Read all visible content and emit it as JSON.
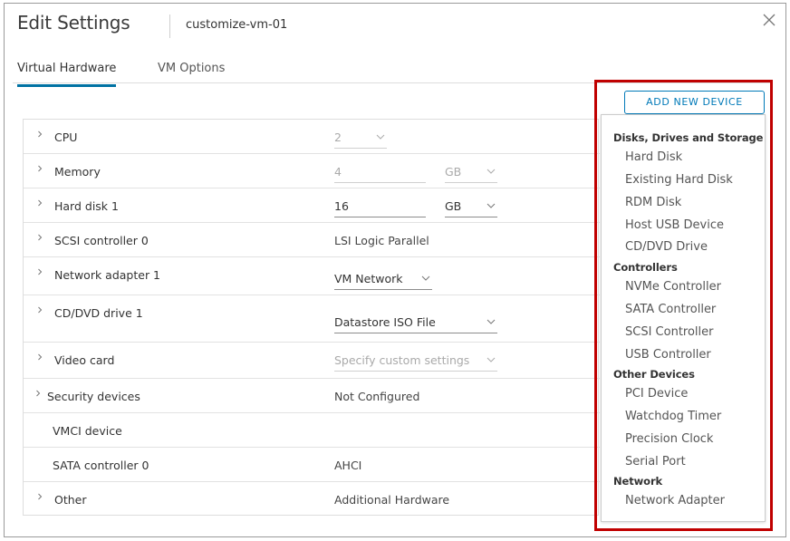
{
  "dialog": {
    "title": "Edit Settings",
    "vm_name": "customize-vm-01"
  },
  "tabs": [
    {
      "label": "Virtual Hardware",
      "active": true
    },
    {
      "label": "VM Options",
      "active": false
    }
  ],
  "add_device": {
    "label": "ADD NEW DEVICE"
  },
  "hardware": {
    "cpu": {
      "label": "CPU",
      "value": "2"
    },
    "memory": {
      "label": "Memory",
      "value": "4",
      "unit": "GB"
    },
    "hard_disk": {
      "label": "Hard disk 1",
      "value": "16",
      "unit": "GB"
    },
    "scsi": {
      "label": "SCSI controller 0",
      "value": "LSI Logic Parallel"
    },
    "network": {
      "label": "Network adapter 1",
      "value": "VM Network"
    },
    "cdvd": {
      "label": "CD/DVD drive 1",
      "value": "Datastore ISO File"
    },
    "video": {
      "label": "Video card",
      "value": "Specify custom settings"
    },
    "security": {
      "label": "Security devices",
      "value": "Not Configured"
    },
    "vmci": {
      "label": "VMCI device",
      "value": ""
    },
    "sata": {
      "label": "SATA controller 0",
      "value": "AHCI"
    },
    "other": {
      "label": "Other",
      "value": "Additional Hardware"
    }
  },
  "device_menu": {
    "disks_header": "Disks, Drives and Storage",
    "disks": [
      "Hard Disk",
      "Existing Hard Disk",
      "RDM Disk",
      "Host USB Device",
      "CD/DVD Drive"
    ],
    "controllers_header": "Controllers",
    "controllers": [
      "NVMe Controller",
      "SATA Controller",
      "SCSI Controller",
      "USB Controller"
    ],
    "other_header": "Other Devices",
    "other": [
      "PCI Device",
      "Watchdog Timer",
      "Precision Clock",
      "Serial Port"
    ],
    "network_header": "Network",
    "network": [
      "Network Adapter"
    ]
  },
  "colors": {
    "accent": "#0079b8",
    "highlight": "#c00000"
  }
}
